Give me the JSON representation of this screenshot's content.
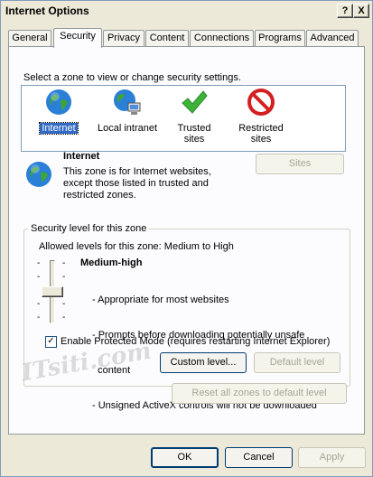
{
  "window": {
    "title": "Internet Options",
    "help_btn": "?",
    "close_btn": "X"
  },
  "tabs": [
    "General",
    "Security",
    "Privacy",
    "Content",
    "Connections",
    "Programs",
    "Advanced"
  ],
  "active_tab": "Security",
  "zone_prompt": "Select a zone to view or change security settings.",
  "zones": [
    {
      "label": "Internet",
      "icon": "globe-icon"
    },
    {
      "label": "Local intranet",
      "icon": "intranet-icon"
    },
    {
      "label": "Trusted sites",
      "icon": "checkmark-icon"
    },
    {
      "label_line1": "Restricted",
      "label_line2": "sites",
      "icon": "restricted-icon"
    }
  ],
  "zone_detail": {
    "name": "Internet",
    "description_lines": [
      "This zone is for Internet websites,",
      "except those listed in trusted and",
      "restricted zones."
    ],
    "sites_button": "Sites"
  },
  "security_level": {
    "group_title": "Security level for this zone",
    "allowed": "Allowed levels for this zone: Medium to High",
    "level_name": "Medium-high",
    "bullets": [
      "- Appropriate for most websites",
      "- Prompts before downloading potentially unsafe",
      "  content",
      "- Unsigned ActiveX controls will not be downloaded"
    ],
    "tick_marks": [
      "-",
      "-",
      "-",
      "-"
    ],
    "protected_mode_label": "Enable Protected Mode (requires restarting Internet Explorer)",
    "protected_mode_checked": "✓",
    "custom_level_button": "Custom level...",
    "default_level_button": "Default level"
  },
  "reset_all_button": "Reset all zones to default level",
  "footer": {
    "ok": "OK",
    "cancel": "Cancel",
    "apply": "Apply"
  },
  "watermark": "ITsiti.com"
}
